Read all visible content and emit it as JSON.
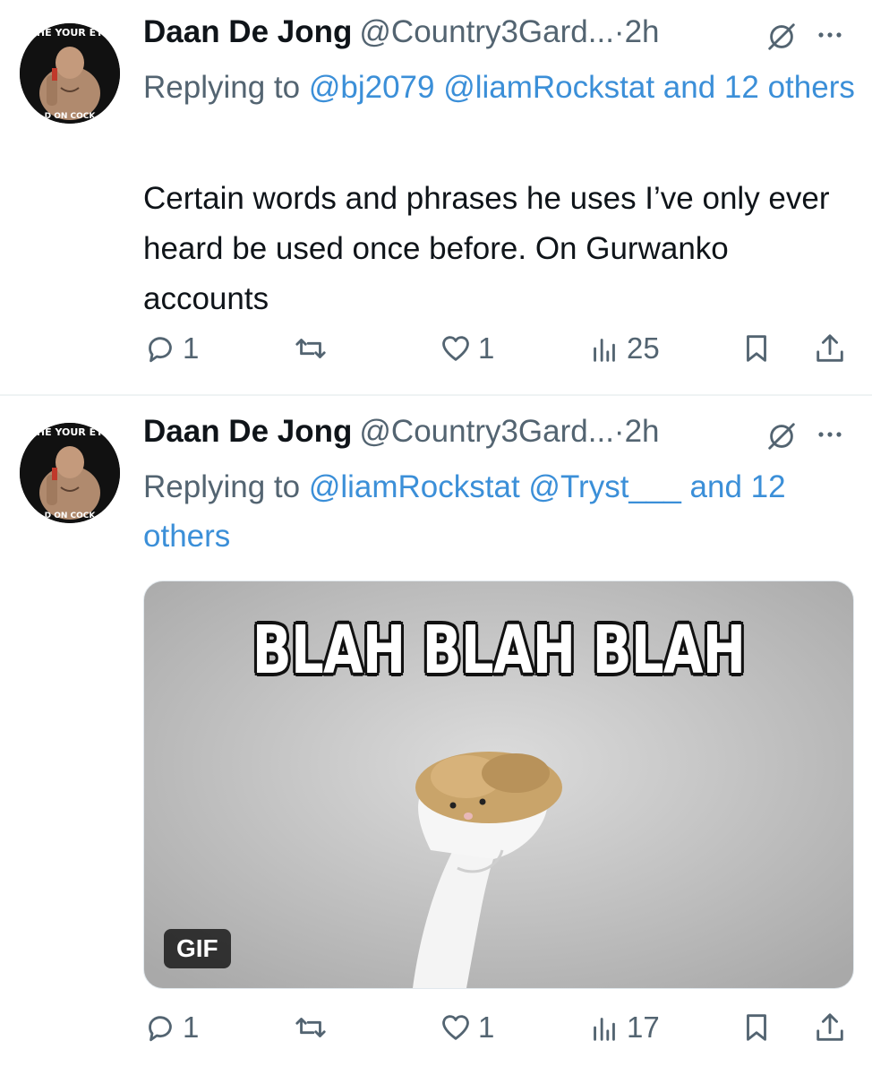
{
  "tweets": [
    {
      "author_name": "Daan De Jong",
      "author_handle": "@Country3Gard...",
      "separator": "·",
      "time": "2h",
      "reply_prefix": "Replying to ",
      "reply_mentions": [
        "@bj2079",
        "@liamRockstat"
      ],
      "reply_suffix": "and 12 others",
      "body": "Certain words and phrases he uses I’ve only ever heard be used once before. On Gurwanko accounts",
      "stats": {
        "replies": "1",
        "likes": "1",
        "views": "25"
      }
    },
    {
      "author_name": "Daan De Jong",
      "author_handle": "@Country3Gard...",
      "separator": "·",
      "time": "2h",
      "reply_prefix": "Replying to ",
      "reply_mentions": [
        "@liamRockstat",
        "@Tryst___"
      ],
      "reply_suffix": "and 12 others",
      "media": {
        "caption": "BLAH BLAH BLAH",
        "badge": "GIF"
      },
      "stats": {
        "replies": "1",
        "likes": "1",
        "views": "17"
      }
    }
  ],
  "avatar_text": {
    "top": "THE YOUR EYE",
    "bottom": "D ON COCK"
  },
  "colors": {
    "link": "#3b8fd8",
    "muted": "#536471",
    "text": "#0f1419"
  }
}
